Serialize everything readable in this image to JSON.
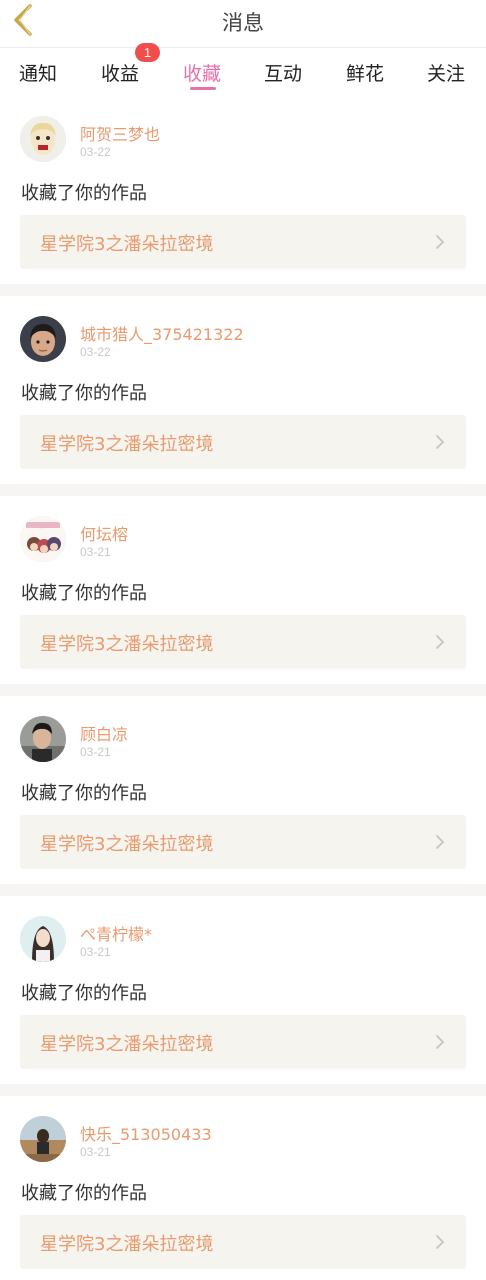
{
  "header": {
    "title": "消息",
    "back_icon": "chevron-left-icon",
    "back_color": "#c9a84a"
  },
  "tabs": [
    {
      "label": "通知"
    },
    {
      "label": "收益",
      "badge": "1"
    },
    {
      "label": "收藏",
      "active": true
    },
    {
      "label": "互动"
    },
    {
      "label": "鲜花"
    },
    {
      "label": "关注"
    }
  ],
  "colors": {
    "accent_pink": "#e872a8",
    "name_orange": "#e99a6e",
    "badge_red": "#f04d4d",
    "card_bg": "#f5f4ee"
  },
  "messages": [
    {
      "username": "阿贺三梦也",
      "date": "03-22",
      "action": "收藏了你的作品",
      "work_title": "星学院3之潘朵拉密境"
    },
    {
      "username": "城市猎人_375421322",
      "date": "03-22",
      "action": "收藏了你的作品",
      "work_title": "星学院3之潘朵拉密境"
    },
    {
      "username": "何坛榕",
      "date": "03-21",
      "action": "收藏了你的作品",
      "work_title": "星学院3之潘朵拉密境"
    },
    {
      "username": "顾白凉",
      "date": "03-21",
      "action": "收藏了你的作品",
      "work_title": "星学院3之潘朵拉密境"
    },
    {
      "username": "ぺ青柠檬*",
      "date": "03-21",
      "action": "收藏了你的作品",
      "work_title": "星学院3之潘朵拉密境"
    },
    {
      "username": "快乐_513050433",
      "date": "03-21",
      "action": "收藏了你的作品",
      "work_title": "星学院3之潘朵拉密境"
    }
  ]
}
